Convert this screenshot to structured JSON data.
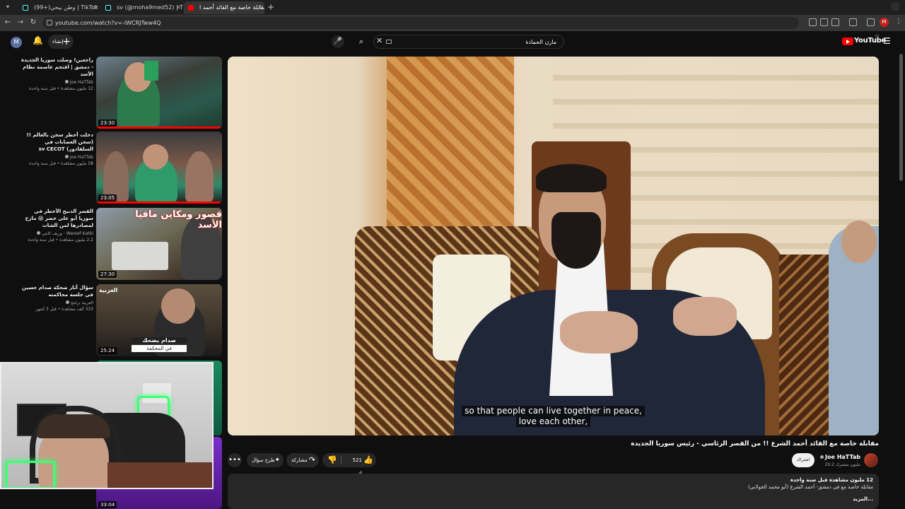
{
  "browser": {
    "tabs": [
      {
        "title": "(99+)وطن بيحي | TikTok - 476",
        "favicon": "tiktok"
      },
      {
        "title": "sv (@moha9med52) | TikTok",
        "favicon": "tiktok"
      },
      {
        "title": "مقابلة خاصة مع القائد أحمد ا",
        "favicon": "youtube",
        "active": true
      }
    ],
    "new_tab_glyph": "+",
    "url": "youtube.com/watch?v=-iWCRJTww4Q",
    "profile_initial": "M"
  },
  "header": {
    "avatar_initial": "M",
    "create_label": "إنشاء",
    "search_value": "مازن الحمادة",
    "logo_word": "YouTube",
    "logo_region": "IQ"
  },
  "recommendations": [
    {
      "title": "راجعين! وصلت سوريا الجديدة - دمشق | اقتحم عاصمة نظام الأسد",
      "channel": "Joe HaTTab",
      "verified": true,
      "stats": "12 مليون مشاهدة • قبل سنة واحدة",
      "duration": "23:30",
      "progress": 1.0
    },
    {
      "title": "دخلت أخطر سجن بالعالم !! (سجن العصابات في السلفادور) sv CECOT",
      "channel": "Joe HaTTab",
      "verified": true,
      "stats": "58 مليون مشاهدة • قبل سنة واحدة",
      "duration": "23:05",
      "progress": 1.0
    },
    {
      "title": "القصر الذبيح الأخطر في سوريا أبو علي خضر 😱 مازح لمصادرها لمن الشات",
      "channel": "Wareef Katbi - وريف كاتبي",
      "verified": true,
      "stats": "2.2 مليون مشاهدة • قبل سنة واحدة",
      "duration": "27:30",
      "overlay": "قصور ومكاين مافيا الأسد",
      "progress": 0
    },
    {
      "title": "سؤال أثار ضحكة صدام حسين في جلسة محاكمته",
      "channel": "العربية برامج",
      "verified": true,
      "stats": "333 ألف مشاهدة • قبل 3 أشهر",
      "duration": "25:24",
      "caption_head": "صدام يضحك",
      "caption_sub": "في المحكمة",
      "brand": "العربية",
      "progress": 0
    },
    {
      "duration": "33:04",
      "progress": 0
    }
  ],
  "player": {
    "subtitle_line1": "so that people can live together in peace,",
    "subtitle_line2": "love each other,"
  },
  "video": {
    "title": "مقابلة خاصة مع القائد أحمد الشرع !! من القصر الرئاسي - رئيس سوريا الجديدة",
    "channel": "Joe HaTTab",
    "subscribers": "20.2 مليون مشترك",
    "subscribe_label": "اشتراك",
    "likes": "521 ألف",
    "share_label": "مشاركة",
    "ask_label": "طرح سؤال",
    "more_glyph": "•••",
    "desc_line1": "12 مليون مشاهدة  قبل سنة واحدة",
    "desc_line2": "مقابلة خاصة مع في دمشق- أحمد الشرع (أبو محمد الجولاني)",
    "desc_more": "...المزيد"
  },
  "colors": {
    "background": "#0f0f0f",
    "accent_red": "#ff0000",
    "pill": "#272727"
  }
}
